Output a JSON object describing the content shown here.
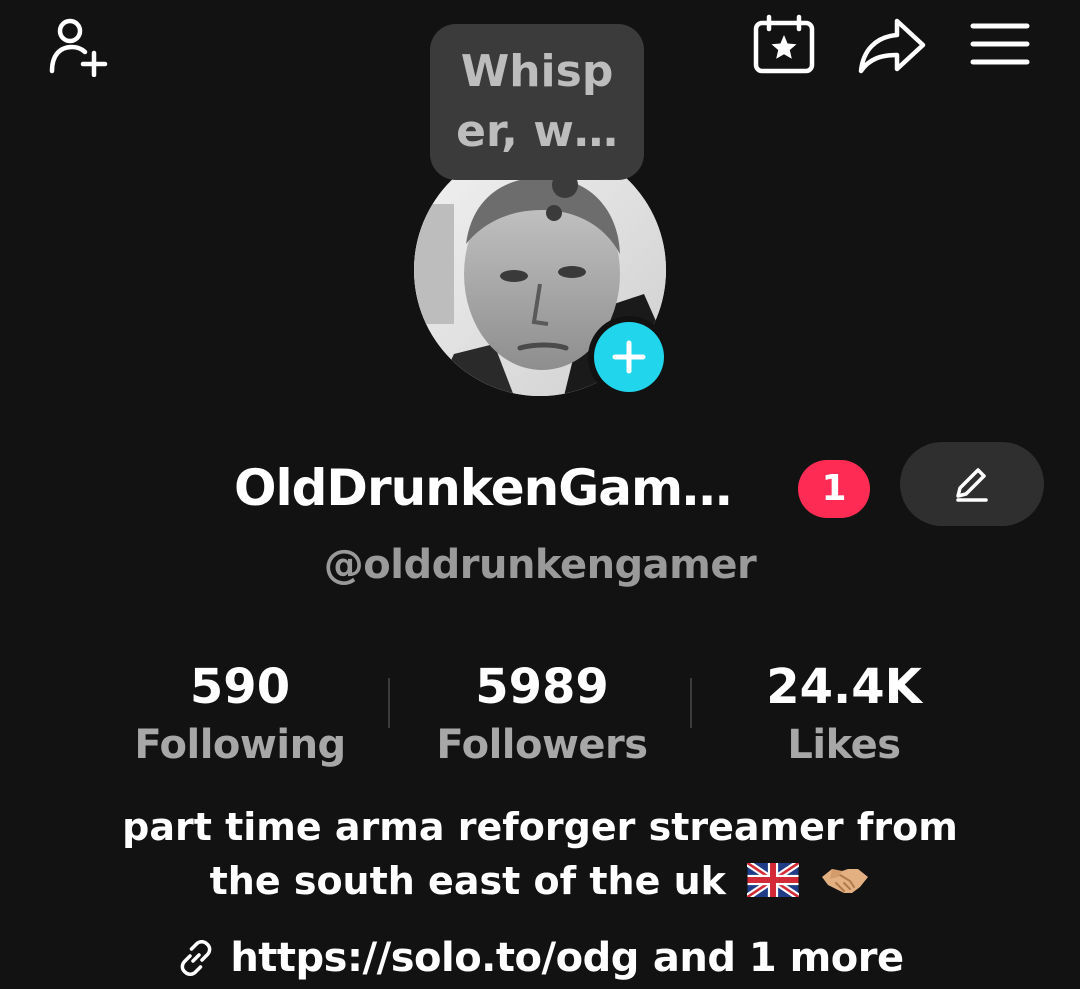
{
  "header": {
    "add_friend_icon": "person-add-icon",
    "calendar_icon": "calendar-star-icon",
    "share_icon": "share-arrow-icon",
    "menu_icon": "hamburger-menu-icon"
  },
  "note_bubble": {
    "text": "Whisper, w…"
  },
  "profile": {
    "display_name": "OldDrunkenGam…",
    "notification_count": "1",
    "username": "@olddrunkengamer",
    "edit_icon": "pencil-icon",
    "follow_badge_icon": "plus-icon"
  },
  "stats": [
    {
      "value": "590",
      "label": "Following"
    },
    {
      "value": "5989",
      "label": "Followers"
    },
    {
      "value": "24.4K",
      "label": "Likes"
    }
  ],
  "bio": {
    "line1": "part time arma reforger streamer from",
    "line2": "the south east of the uk"
  },
  "link": {
    "url": "https://solo.to/odg",
    "more": "and 1 more"
  },
  "colors": {
    "background": "#121212",
    "accent_cyan": "#20d5ec",
    "badge_red": "#fe2c55",
    "muted_text": "#9a9a9a"
  }
}
